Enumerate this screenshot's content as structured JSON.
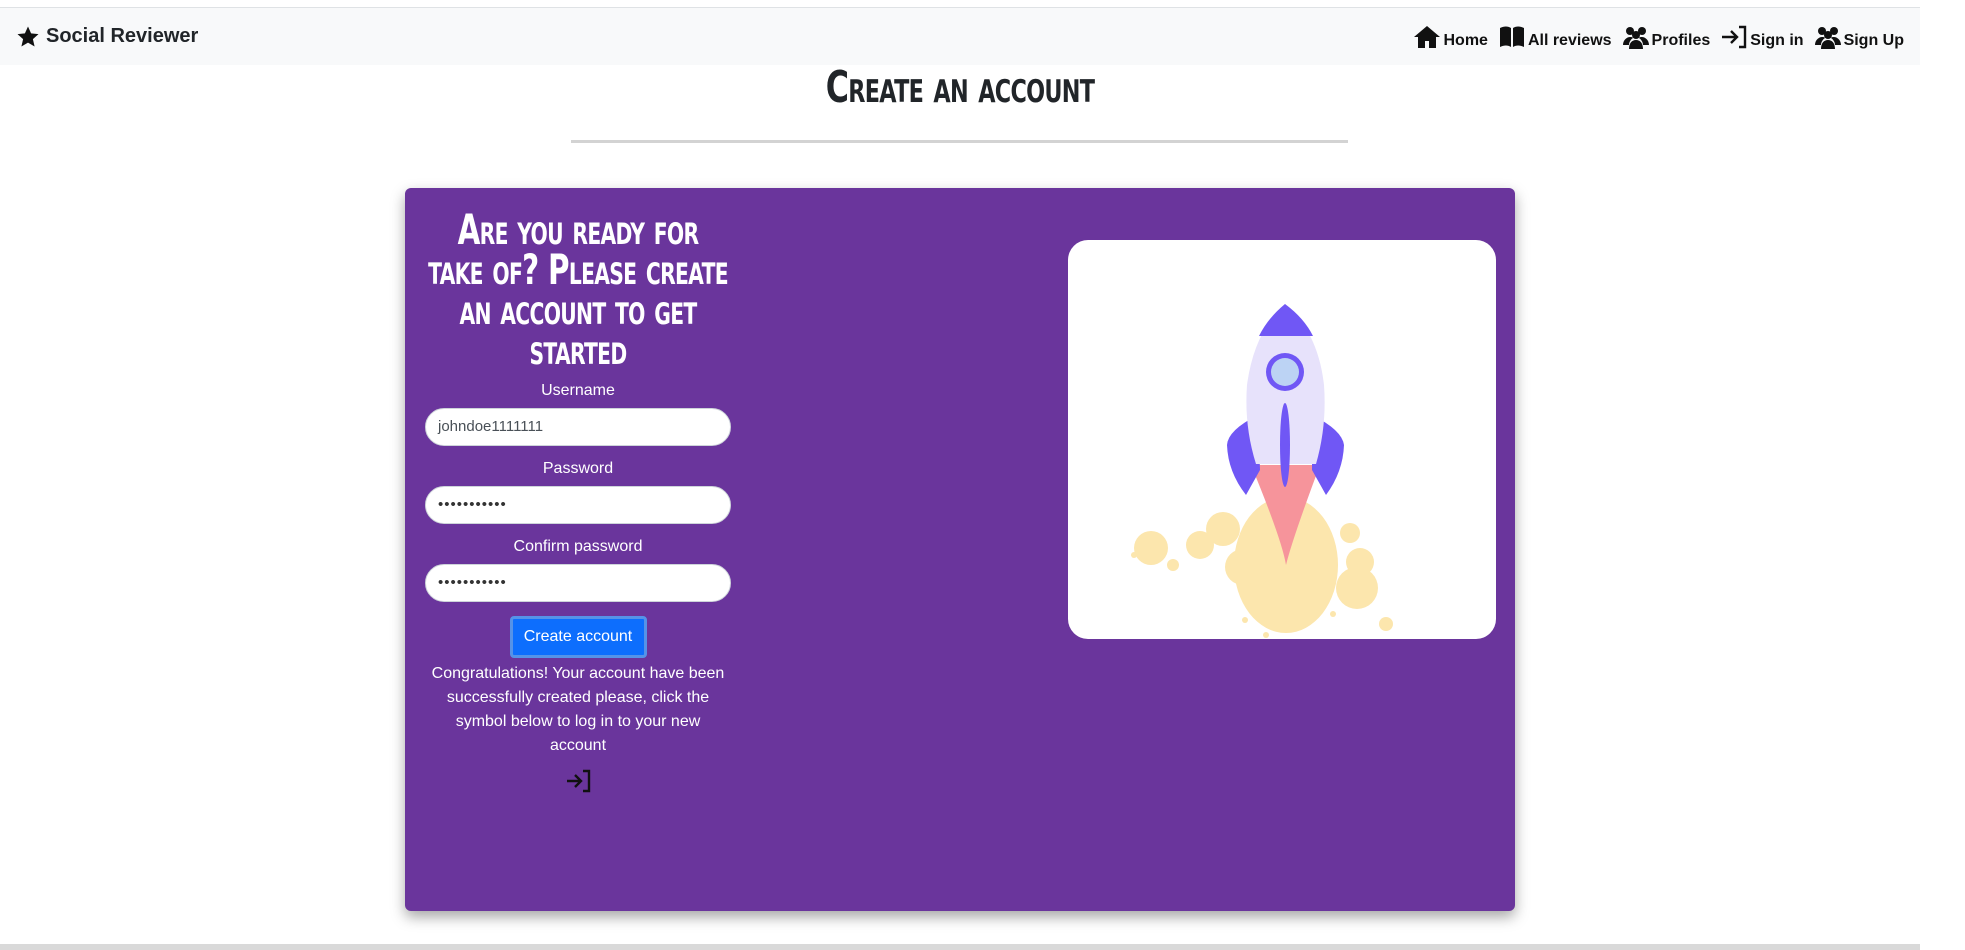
{
  "navbar": {
    "brand": "Social Reviewer",
    "links": {
      "home": "Home",
      "all_reviews": "All reviews",
      "profiles": "Profiles",
      "sign_in": "Sign in",
      "sign_up": "Sign Up"
    }
  },
  "page": {
    "title": "Create an account"
  },
  "form": {
    "heading_lines": [
      "Are you ready for",
      "take of? Please create",
      "an account to get",
      "started"
    ],
    "username_label": "Username",
    "username_value": "johndoe1111111",
    "password_label": "Password",
    "password_value": "•••••••••••",
    "confirm_label": "Confirm password",
    "confirm_value": "•••••••••••",
    "submit_label": "Create account",
    "success_message": "Congratulations! Your account have been successfully created please, click the symbol below to log in to your new account"
  },
  "colors": {
    "card": "#6a359c",
    "button": "#0d6efd",
    "rocket_body": "#e7e2fb",
    "rocket_accent": "#7057f5",
    "flame": "#f6949b",
    "smoke": "#fce6ad"
  },
  "icons": {
    "brand": "star-icon",
    "home": "house-icon",
    "all_reviews": "book-icon",
    "profiles": "people-icon",
    "sign_in": "sign-in-icon",
    "sign_up": "people-icon",
    "login_link": "sign-in-icon"
  }
}
